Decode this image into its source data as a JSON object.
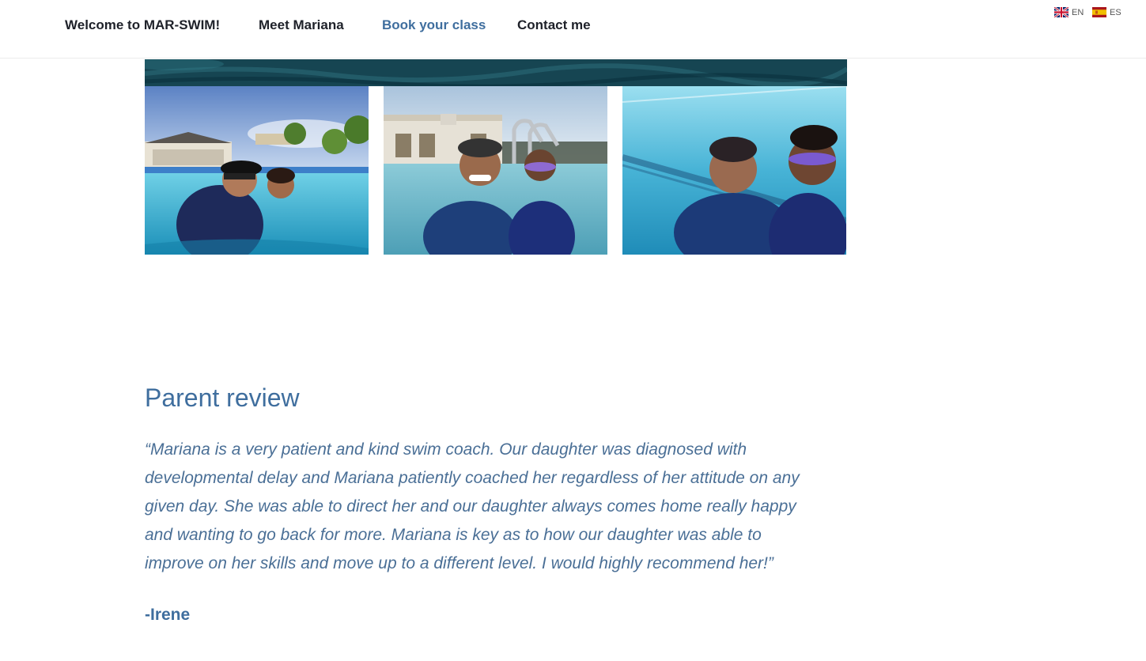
{
  "nav": {
    "items": [
      {
        "label": "Welcome to MAR-SWIM!",
        "active": false
      },
      {
        "label": "Meet Mariana",
        "active": false
      },
      {
        "label": "Book your class",
        "active": true
      },
      {
        "label": "Contact me",
        "active": false
      }
    ],
    "active_color": "#3f6e9e",
    "text_color": "#1e2129"
  },
  "languages": [
    {
      "code": "EN",
      "flag": "uk-flag-icon"
    },
    {
      "code": "ES",
      "flag": "spain-flag-icon"
    }
  ],
  "gallery": {
    "images": [
      {
        "name": "pool-photo-1",
        "subject": "coach and child in outdoor pool with clubhouse"
      },
      {
        "name": "pool-photo-2",
        "subject": "coach and child at pool ladder"
      },
      {
        "name": "pool-photo-3",
        "subject": "coach and child underwater with goggles"
      }
    ]
  },
  "review": {
    "title": "Parent review",
    "quote_lines": [
      "“Mariana is a very patient and kind swim coach.  Our daughter was diagnosed with",
      "developmental delay and Mariana patiently coached her regardless of her attitude on any",
      "given day.  She was able to direct her and our daughter always comes home really happy",
      "and wanting to go back for more.  Mariana is key as to how our daughter was able to",
      "improve on her skills and move up to a different level.  I would highly recommend her!”"
    ],
    "author": "-Irene"
  }
}
